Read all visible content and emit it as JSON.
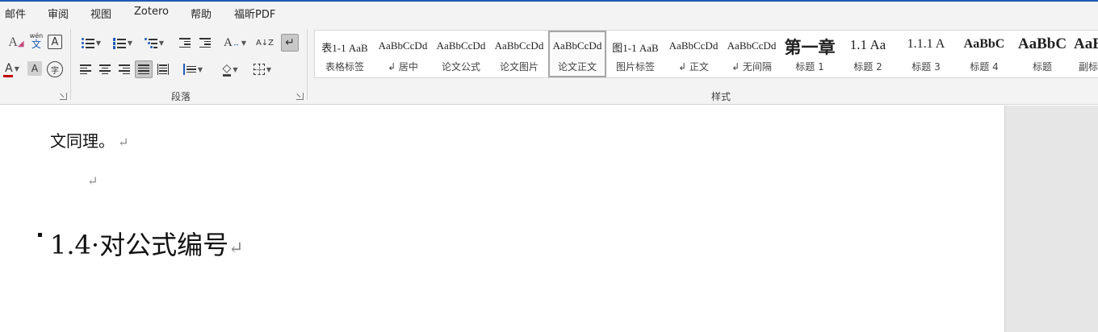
{
  "menu_tabs": [
    "邮件",
    "审阅",
    "视图",
    "Zotero",
    "帮助",
    "福昕PDF"
  ],
  "ribbon": {
    "font_group": {
      "phonetic_label": "wén",
      "phonetic_char": "文",
      "char_border_label": "A",
      "font_color_label": "A",
      "font_color": "#c00000",
      "shading_label": "A",
      "enclose_label": "字"
    },
    "paragraph_group": {
      "label": "段落",
      "sort_label": "A↓Z"
    },
    "styles_group": {
      "label": "样式",
      "items": [
        {
          "preview": "表1-1 AaB",
          "name": "表格标签"
        },
        {
          "preview": "AaBbCcDd",
          "name": "↲ 居中"
        },
        {
          "preview": "AaBbCcDd",
          "name": "论文公式"
        },
        {
          "preview": "AaBbCcDd",
          "name": "论文图片"
        },
        {
          "preview": "AaBbCcDd",
          "name": "论文正文",
          "selected": true
        },
        {
          "preview": "图1-1 AaB",
          "name": "图片标签"
        },
        {
          "preview": "AaBbCcDd",
          "name": "↲ 正文"
        },
        {
          "preview": "AaBbCcDd",
          "name": "↲ 无间隔"
        },
        {
          "preview": "第一章",
          "name": "标题 1"
        },
        {
          "preview": "1.1 Aa",
          "name": "标题 2"
        },
        {
          "preview": "1.1.1 A",
          "name": "标题 3"
        },
        {
          "preview": "AaBbC",
          "name": "标题 4"
        },
        {
          "preview": "AaBbC",
          "name": "标题"
        },
        {
          "preview": "AaB",
          "name": "副标"
        }
      ]
    }
  },
  "document": {
    "line1": "文同理。",
    "heading": "1.4·对公式编号",
    "paragraph_mark": "↵"
  }
}
